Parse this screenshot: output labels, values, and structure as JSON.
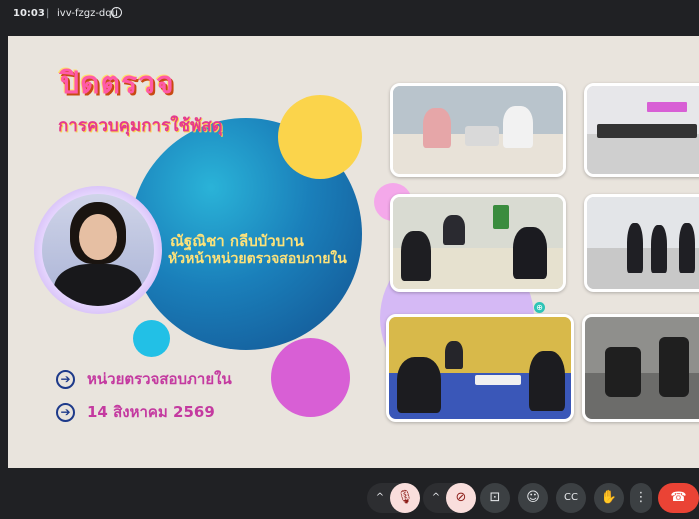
{
  "topbar": {
    "time": "10:03",
    "separator": "|",
    "meeting_code": "ivv-fzgz-dqu",
    "info_icon": "info-icon"
  },
  "slide": {
    "title": "ปิดตรวจ",
    "subtitle": "การควบคุมการใช้พัสดุ",
    "person_name": "ณัฐณิชา  กลีบบัวบาน",
    "person_role": "หัวหน้าหน่วยตรวจสอบภายใน",
    "rows": [
      {
        "text": "หน่วยตรวจสอบภายใน",
        "icon": "arrow-right-circle-icon"
      },
      {
        "text": "14  สิงหาคม  2569",
        "icon": "arrow-right-circle-icon"
      }
    ],
    "colors": {
      "background": "#e9e4dd",
      "title": "#ff5aa8",
      "accent_text": "#fde27a",
      "row_text": "#c43aa0"
    }
  },
  "toolbar": {
    "mic": {
      "icon": "mic-off-icon",
      "caret": "^"
    },
    "camera": {
      "icon": "camera-off-icon",
      "caret": "^"
    },
    "present": {
      "icon": "present-screen-icon",
      "glyph": "⊡"
    },
    "reactions": {
      "icon": "emoji-icon",
      "glyph": "☺"
    },
    "captions": {
      "icon": "captions-icon",
      "glyph": "CC"
    },
    "hand": {
      "icon": "raise-hand-icon",
      "glyph": "✋"
    },
    "more": {
      "icon": "more-vert-icon",
      "glyph": "⋮"
    },
    "end_call": {
      "icon": "call-end-icon",
      "glyph": "☎"
    }
  }
}
